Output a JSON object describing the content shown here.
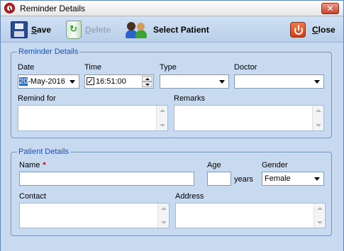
{
  "window": {
    "title": "Reminder Details",
    "close_glyph": "✕"
  },
  "toolbar": {
    "save": {
      "label_u": "S",
      "label_rest": "ave",
      "icon": "floppy-disk-icon"
    },
    "delete": {
      "label_u": "D",
      "label_rest": "elete",
      "icon": "recycle-bin-icon",
      "enabled": false
    },
    "select_patient": {
      "label": "Select Patient",
      "icon": "people-icon"
    },
    "close": {
      "label_u": "C",
      "label_rest": "lose",
      "icon": "power-icon"
    }
  },
  "reminder": {
    "legend": "Reminder Details",
    "date": {
      "label": "Date",
      "day": "20",
      "rest": "-May-2016"
    },
    "time": {
      "label": "Time",
      "value": "16:51:00"
    },
    "type": {
      "label": "Type",
      "value": ""
    },
    "doctor": {
      "label": "Doctor",
      "value": ""
    },
    "remind_for": {
      "label": "Remind for",
      "value": ""
    },
    "remarks": {
      "label": "Remarks",
      "value": ""
    }
  },
  "patient": {
    "legend": "Patient Details",
    "name": {
      "label": "Name",
      "required_mark": "*",
      "value": ""
    },
    "age": {
      "label": "Age",
      "value": "",
      "unit": "years"
    },
    "gender": {
      "label": "Gender",
      "value": "Female"
    },
    "contact": {
      "label": "Contact",
      "value": ""
    },
    "address": {
      "label": "Address",
      "value": ""
    }
  },
  "colors": {
    "legend": "#1e4fb0",
    "panel": "#c8daf0",
    "required": "#d00000"
  }
}
